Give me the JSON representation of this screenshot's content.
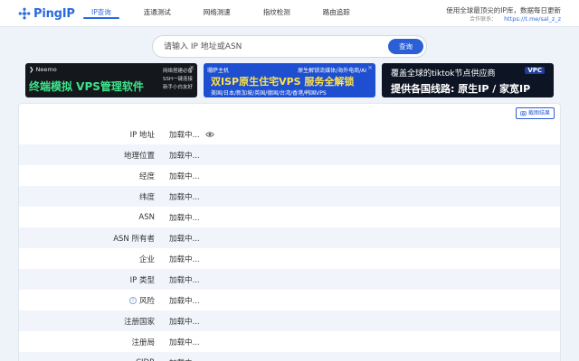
{
  "brand": {
    "name": "PingIP",
    "logo_icon": "ping-logo-icon",
    "color": "#2a6ae0"
  },
  "nav": [
    {
      "label": "IP查询",
      "active": true
    },
    {
      "label": "连通测试",
      "active": false
    },
    {
      "label": "网络测速",
      "active": false
    },
    {
      "label": "指纹检测",
      "active": false
    },
    {
      "label": "路由追踪",
      "active": false
    }
  ],
  "header": {
    "tagline": "使用全球最顶尖的IP库，数据每日更新",
    "contact_label": "合作联系：",
    "contact_link": "https://t.me/sal_z_z"
  },
  "search": {
    "placeholder": "请输入 IP 地址或ASN",
    "button_label": "查询"
  },
  "ads": {
    "ad1": {
      "brand": "Neemo",
      "title": "终端模拟 VPS管理软件",
      "side": [
        "网络搭建必备",
        "SSH一键连接",
        "新手小白友好"
      ]
    },
    "ad2": {
      "brand": "珊萨主机",
      "tag": "原生解锁流媒体/海外电商/AI",
      "title": "双ISP原生住宅VPS  服务全解锁",
      "sub": "美国/日本/新加坡/英国/德国/台湾/香港/韩国VPS"
    },
    "ad3": {
      "line1": "覆盖全球的tiktok节点供应商",
      "line2": "提供各国线路: 原生IP / 家宽IP",
      "logo": "VPC"
    },
    "close_glyph": "×"
  },
  "result": {
    "export_label": "截图结果",
    "rows": [
      {
        "label": "IP 地址",
        "value": "加载中...",
        "has_eye": true,
        "has_info": false
      },
      {
        "label": "地理位置",
        "value": "加载中...",
        "has_eye": false,
        "has_info": false
      },
      {
        "label": "经度",
        "value": "加载中...",
        "has_eye": false,
        "has_info": false
      },
      {
        "label": "纬度",
        "value": "加载中...",
        "has_eye": false,
        "has_info": false
      },
      {
        "label": "ASN",
        "value": "加载中...",
        "has_eye": false,
        "has_info": false
      },
      {
        "label": "ASN 所有者",
        "value": "加载中...",
        "has_eye": false,
        "has_info": false
      },
      {
        "label": "企业",
        "value": "加载中...",
        "has_eye": false,
        "has_info": false
      },
      {
        "label": "IP 类型",
        "value": "加载中...",
        "has_eye": false,
        "has_info": false
      },
      {
        "label": "风险",
        "value": "加载中...",
        "has_eye": false,
        "has_info": true
      },
      {
        "label": "注册国家",
        "value": "加载中...",
        "has_eye": false,
        "has_info": false
      },
      {
        "label": "注册局",
        "value": "加载中...",
        "has_eye": false,
        "has_info": false
      },
      {
        "label": "CIDR",
        "value": "加载中...",
        "has_eye": false,
        "has_info": false
      }
    ]
  },
  "icons": {
    "info": "i"
  }
}
